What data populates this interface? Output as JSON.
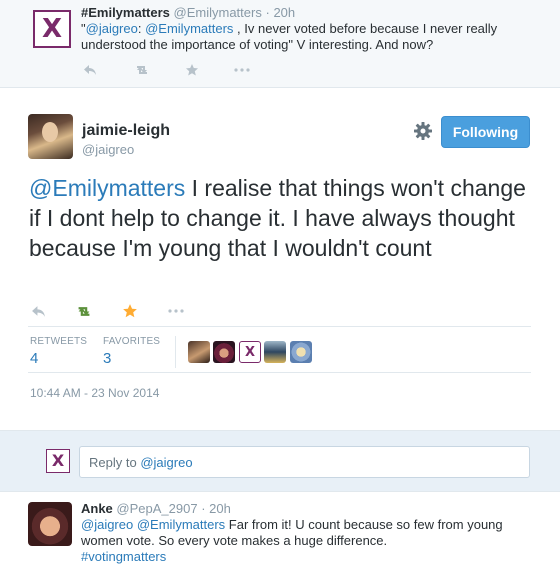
{
  "top_tweet": {
    "avatar_letter": "X",
    "name": "#Emilymatters",
    "handle": "@Emilymatters",
    "separator": "·",
    "time": "20h",
    "text_parts": [
      {
        "text": "\"",
        "link": false
      },
      {
        "text": "@jaigreo",
        "link": true
      },
      {
        "text": ": ",
        "link": false
      },
      {
        "text": "@Emilymatters",
        "link": true
      },
      {
        "text": " , Iv never voted before because I never really understood the importance of voting\"  V interesting. And now?",
        "link": false
      }
    ],
    "actions": [
      "reply-icon",
      "retweet-icon",
      "favorite-icon",
      "more-icon"
    ]
  },
  "main_tweet": {
    "name": "jaimie-leigh",
    "handle": "@jaigreo",
    "follow_label": "Following",
    "mention": "@Emilymatters",
    "text": "  I realise that things won't change if I dont help to change it. I have always thought because I'm young that I wouldn't count",
    "retweets_label": "RETWEETS",
    "retweets_value": "4",
    "favorites_label": "FAVORITES",
    "favorites_value": "3",
    "favoriters": [
      "favoriter-1",
      "favoriter-2",
      "favoriter-x",
      "favoriter-4",
      "favoriter-5"
    ],
    "favoriter_x_letter": "X",
    "timestamp": "10:44 AM - 23 Nov 2014",
    "colors": {
      "retweet": "#5c913b",
      "favorite": "#ffac33",
      "follow": "#4a9fde"
    }
  },
  "reply_box": {
    "avatar_letter": "X",
    "prefix": "Reply to ",
    "target": "@jaigreo"
  },
  "bottom_tweet": {
    "name": "Anke",
    "handle": "@PepA_2907",
    "separator": "·",
    "time": "20h",
    "mention1": "@jaigreo",
    "mention2": "@Emilymatters",
    "text": " Far from it! U count because so few from young women vote. So every vote makes a huge difference.",
    "hashtag": "#votingmatters"
  }
}
